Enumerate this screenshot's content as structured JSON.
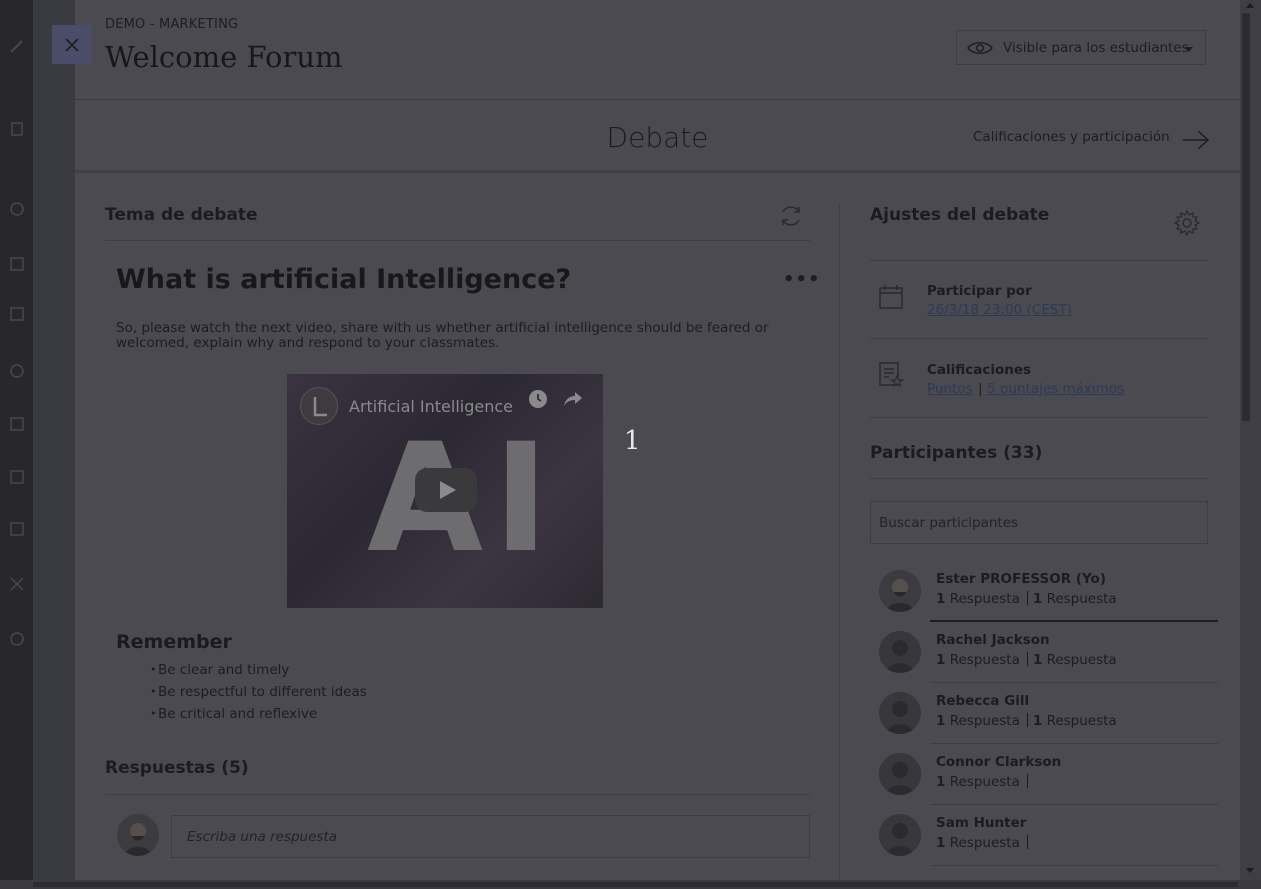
{
  "header": {
    "breadcrumb": "DEMO - MARKETING",
    "title": "Welcome Forum",
    "visibility_label": "Visible para los estudiantes"
  },
  "tabbar": {
    "title": "Debate",
    "grades_link": "Calificaciones y participación"
  },
  "topic_section": {
    "heading": "Tema de debate",
    "topic_title": "What is artificial Intelligence?",
    "more_label": "•••",
    "description": "So, please watch the next video, share with us whether artificial intelligence should be feared or welcomed, explain why and respond to your classmates.",
    "video": {
      "title": "Artificial Intelligence",
      "thumbnail_text": "AI"
    },
    "marker": "1",
    "remember_heading": "Remember",
    "bullets": [
      "Be clear and timely",
      "Be respectful to different ideas",
      "Be critical and reflexive"
    ],
    "replies_heading": "Respuestas (5)",
    "reply_placeholder": "Escriba una respuesta"
  },
  "settings": {
    "heading": "Ajustes del debate",
    "due_label": "Participar por",
    "due_value": "26/3/18 23:00 (CEST)",
    "grades_label": "Calificaciones",
    "grades_points": "Puntos",
    "grades_sep": "|",
    "grades_max": "5 puntajes máximos"
  },
  "participants": {
    "heading": "Participantes (33)",
    "search_placeholder": "Buscar participantes",
    "items": [
      {
        "name": "Ester PROFESSOR (Yo)",
        "count1": "1",
        "label1": "Respuesta",
        "count2": "1",
        "label2": "Respuesta"
      },
      {
        "name": "Rachel Jackson",
        "count1": "1",
        "label1": "Respuesta",
        "count2": "1",
        "label2": "Respuesta"
      },
      {
        "name": "Rebecca Gill",
        "count1": "1",
        "label1": "Respuesta",
        "count2": "1",
        "label2": "Respuesta"
      },
      {
        "name": "Connor Clarkson",
        "count1": "1",
        "label1": "Respuesta",
        "count2": "",
        "label2": ""
      },
      {
        "name": "Sam Hunter",
        "count1": "1",
        "label1": "Respuesta",
        "count2": "",
        "label2": ""
      }
    ]
  }
}
